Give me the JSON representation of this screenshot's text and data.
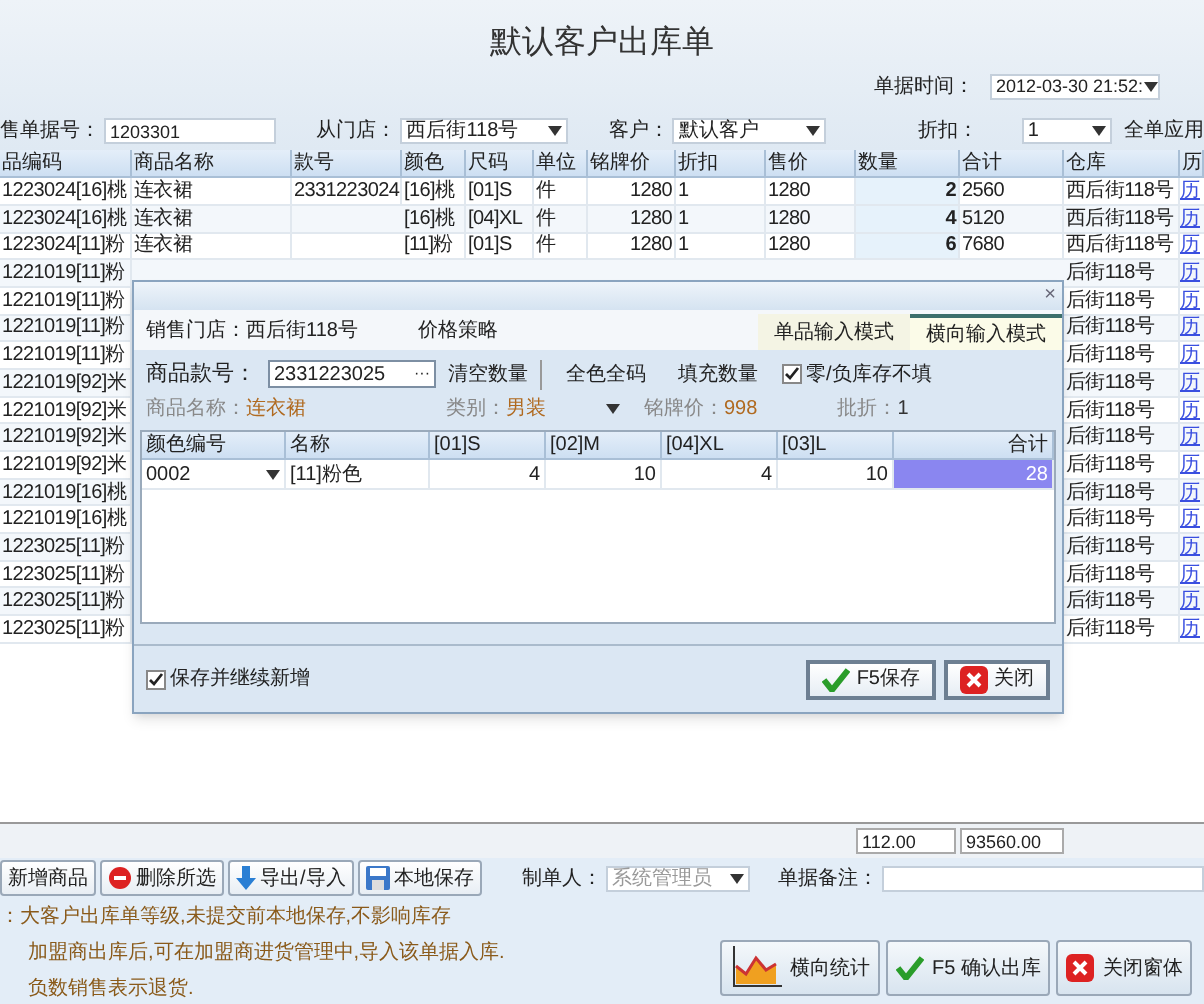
{
  "title": "默认客户出库单",
  "header": {
    "date_label": "单据时间：",
    "date_value": "2012-03-30 21:52:",
    "order_no_label": "售单据号：",
    "order_no": "1203301",
    "store_label": "从门店：",
    "store": "西后街118号",
    "customer_label": "客户：",
    "customer": "默认客户",
    "discount_label": "折扣：",
    "discount": "1",
    "apply_all": "全单应用"
  },
  "table": {
    "columns": [
      "品编码",
      "商品名称",
      "款号",
      "颜色",
      "尺码",
      "单位",
      "铭牌价",
      "折扣",
      "售价",
      "数量",
      "合计",
      "仓库",
      "历"
    ],
    "rows": [
      {
        "code": "1223024[16]桃",
        "name": "连衣裙",
        "style_no": "2331223024",
        "shade": "[16]桃",
        "size": "[01]S",
        "unit": "件",
        "list_price": "1280",
        "discount": "1",
        "price": "1280",
        "qty": "2",
        "total": "2560",
        "warehouse": "西后街118号",
        "history": "历"
      },
      {
        "code": "1223024[16]桃",
        "name": "连衣裙",
        "shade": "[16]桃",
        "size": "[04]XL",
        "unit": "件",
        "list_price": "1280",
        "discount": "1",
        "price": "1280",
        "qty": "4",
        "total": "5120",
        "warehouse": "西后街118号",
        "history": "历"
      },
      {
        "code": "1223024[11]粉",
        "name": "连衣裙",
        "shade": "[11]粉",
        "size": "[01]S",
        "unit": "件",
        "list_price": "1280",
        "discount": "1",
        "price": "1280",
        "qty": "6",
        "total": "7680",
        "warehouse": "西后街118号",
        "history": "历"
      },
      {
        "code": "1221019[11]粉",
        "warehouse": "后街118号",
        "history": "历"
      },
      {
        "code": "1221019[11]粉",
        "warehouse": "后街118号",
        "history": "历"
      },
      {
        "code": "1221019[11]粉",
        "warehouse": "后街118号",
        "history": "历"
      },
      {
        "code": "1221019[11]粉",
        "warehouse": "后街118号",
        "history": "历"
      },
      {
        "code": "1221019[92]米",
        "warehouse": "后街118号",
        "history": "历"
      },
      {
        "code": "1221019[92]米",
        "warehouse": "后街118号",
        "history": "历"
      },
      {
        "code": "1221019[92]米",
        "warehouse": "后街118号",
        "history": "历"
      },
      {
        "code": "1221019[92]米",
        "warehouse": "后街118号",
        "history": "历"
      },
      {
        "code": "1221019[16]桃",
        "warehouse": "后街118号",
        "history": "历"
      },
      {
        "code": "1221019[16]桃",
        "warehouse": "后街118号",
        "history": "历"
      },
      {
        "code": "1223025[11]粉",
        "warehouse": "后街118号",
        "history": "历"
      },
      {
        "code": "1223025[11]粉",
        "warehouse": "后街118号",
        "history": "历"
      },
      {
        "code": "1223025[11]粉",
        "warehouse": "后街118号",
        "history": "历"
      },
      {
        "code": "1223025[11]粉",
        "warehouse": "后街118号",
        "history": "历"
      }
    ]
  },
  "totals": {
    "qty": "112.00",
    "total": "93560.00"
  },
  "toolbar": [
    {
      "label": "新增商品",
      "kind": "plain"
    },
    {
      "label": "删除所选",
      "kind": "delete"
    },
    {
      "label": "导出/导入",
      "kind": "export"
    },
    {
      "label": "本地保存",
      "kind": "save"
    }
  ],
  "maker_label": "制单人：",
  "maker": "系统管理员",
  "remark_label": "单据备注：",
  "notes": [
    "：大客户出库单等级,未提交前本地保存,不影响库存",
    "加盟商出库后,可在加盟商进货管理中,导入该单据入库.",
    "负数销售表示退货."
  ],
  "actions": [
    {
      "label": "横向统计",
      "kind": "chart"
    },
    {
      "label": "F5 确认出库",
      "kind": "confirm"
    },
    {
      "label": "关闭窗体",
      "kind": "close"
    }
  ],
  "dialog": {
    "close": "×",
    "store_label": "销售门店：",
    "store": "西后街118号",
    "price_strategy": "价格策略",
    "tabs": [
      {
        "label": "单品输入模式",
        "selected": false
      },
      {
        "label": "横向输入模式",
        "selected": true
      }
    ],
    "style_label": "商品款号：",
    "style_value": "2331223025",
    "browse": "···",
    "clear_qty": "清空数量",
    "all_color_size": "全色全码",
    "fill_qty": "填充数量",
    "skip_zero": {
      "label": "零/负库存不填",
      "checked": true
    },
    "name_label": "商品名称：",
    "name": "连衣裙",
    "category_label": "类别：",
    "category": "男装",
    "list_price_label": "铭牌价：",
    "list_price": "998",
    "batch_discount_label": "批折：",
    "batch_discount": "1",
    "grid": {
      "columns": [
        "颜色编号",
        "名称",
        "[01]S",
        "[02]M",
        "[04]XL",
        "[03]L",
        "合计"
      ],
      "rows": [
        {
          "cells": [
            "0002",
            "[11]粉色",
            "4",
            "10",
            "4",
            "10",
            "28"
          ]
        }
      ]
    },
    "save_continue": {
      "label": "保存并继续新增",
      "checked": true
    },
    "buttons": [
      {
        "label": "F5保存",
        "kind": "confirm"
      },
      {
        "label": "关闭",
        "kind": "close"
      }
    ]
  }
}
